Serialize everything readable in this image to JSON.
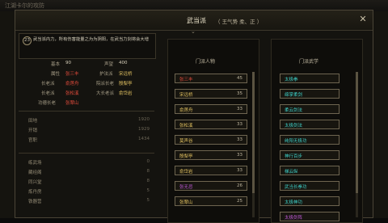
{
  "background": {
    "top_label": "江湖卡尔的攻防"
  },
  "window": {
    "title": "武当派",
    "subtitle": "（ 王气势   柔、正 ）",
    "close_icon": "close-icon"
  },
  "intro": {
    "index": "23",
    "text": "武当派内力，所有伤害能量之为为阴阳，在武当力剑将会大增"
  },
  "stats": [
    {
      "label": "基本",
      "value": "90"
    },
    {
      "label": "声望",
      "value": "400"
    },
    {
      "label": "属性",
      "value": "张三丰",
      "color": "#e24b3b"
    },
    {
      "label": "护法派",
      "value": "宋远桥",
      "color": "#e0c060"
    },
    {
      "label": "长老派",
      "value": "俞莲舟",
      "color": "#e24b3b"
    },
    {
      "label": "院派长老",
      "value": "殷梨亭",
      "color": "#e0c060"
    },
    {
      "label": "长老派",
      "value": "张松溪",
      "color": "#e24b3b"
    },
    {
      "label": "大长老派",
      "value": "俞岱岩",
      "color": "#e0c060"
    },
    {
      "label": "功德长老",
      "value": "张翠山",
      "color": "#e24b3b"
    }
  ],
  "resources": [
    {
      "label": "田地",
      "value": "1920"
    },
    {
      "label": "开销",
      "value": "1929"
    },
    {
      "label": "官职",
      "value": "1434"
    }
  ],
  "buildings": [
    {
      "label": "练武场",
      "value": "0"
    },
    {
      "label": "藏经阁",
      "value": "8"
    },
    {
      "label": "同兴堂",
      "value": "8"
    },
    {
      "label": "炼丹房",
      "value": "5"
    },
    {
      "label": "铁器营",
      "value": "5"
    }
  ],
  "members": {
    "header": "门派人物",
    "items": [
      {
        "name": "张三丰",
        "value": "45",
        "color": "#e24b3b"
      },
      {
        "name": "宋远桥",
        "value": "35",
        "color": "#e0c060"
      },
      {
        "name": "俞莲舟",
        "value": "33",
        "color": "#e0c060"
      },
      {
        "name": "张松溪",
        "value": "33",
        "color": "#e0c060"
      },
      {
        "name": "莫声谷",
        "value": "33",
        "color": "#e0c060"
      },
      {
        "name": "殷梨亭",
        "value": "33",
        "color": "#e0c060"
      },
      {
        "name": "俞岱岩",
        "value": "33",
        "color": "#e0c060"
      },
      {
        "name": "张无忌",
        "value": "26",
        "color": "#c05ad8"
      },
      {
        "name": "张翠山",
        "value": "25",
        "color": "#e0c060"
      }
    ]
  },
  "skills": {
    "header": "门派武学",
    "items": [
      {
        "name": "太极拳",
        "color": "#3ed0c8"
      },
      {
        "name": "绵掌柔剑",
        "color": "#3ed0c8"
      },
      {
        "name": "柔云剑法",
        "color": "#3ed0c8"
      },
      {
        "name": "太极剑法",
        "color": "#3ed0c8"
      },
      {
        "name": "纯阳无极功",
        "color": "#3ed0c8"
      },
      {
        "name": "神行百步",
        "color": "#3ed0c8"
      },
      {
        "name": "梯云纵",
        "color": "#3ed0c8"
      },
      {
        "name": "武当长拳功",
        "color": "#3ed0c8"
      },
      {
        "name": "太极神功",
        "color": "#3ed0c8"
      },
      {
        "name": "太极剑阵",
        "color": "#c05ad8"
      }
    ]
  }
}
